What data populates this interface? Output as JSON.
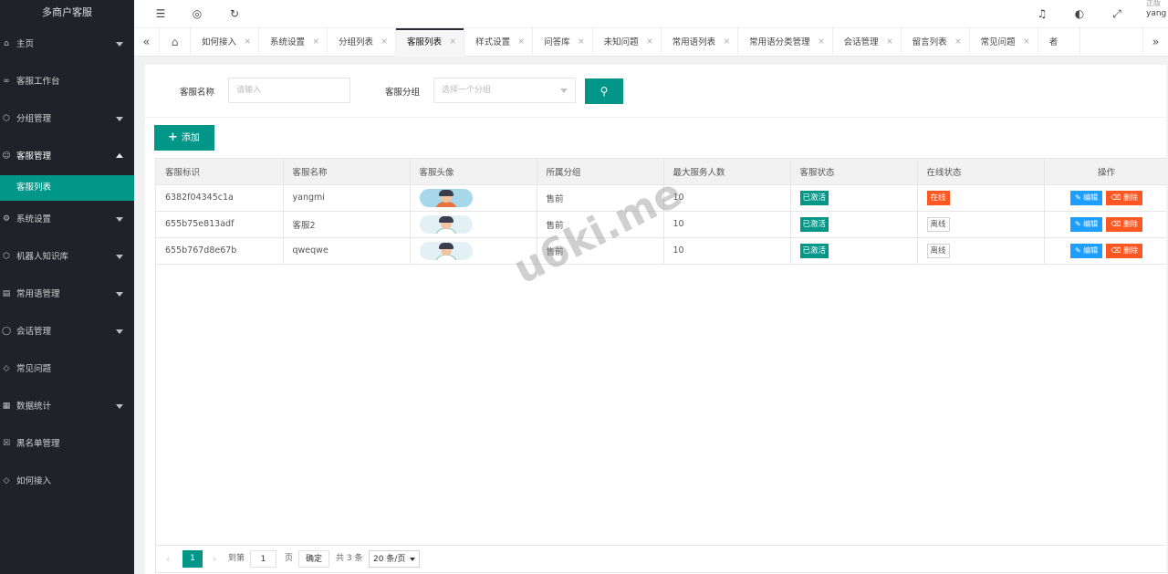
{
  "app": {
    "title": "多商户客服"
  },
  "header": {
    "menu_icon": "☰",
    "globe_icon": "◎",
    "refresh_icon": "↻",
    "bell_icon": "♫",
    "theme_icon": "◐",
    "fullscreen_icon": "⤢",
    "user_line1": "正版",
    "user_line2": "yang"
  },
  "sidebar": {
    "items": [
      {
        "label": "主页",
        "icon": "⌂"
      },
      {
        "label": "客服工作台",
        "icon": "∞"
      },
      {
        "label": "分组管理",
        "icon": "⬡"
      },
      {
        "label": "客服管理",
        "icon": "☺"
      },
      {
        "label": "客服列表",
        "icon": ""
      },
      {
        "label": "系统设置",
        "icon": "⚙"
      },
      {
        "label": "机器人知识库",
        "icon": "⬡"
      },
      {
        "label": "常用语管理",
        "icon": "▤"
      },
      {
        "label": "会话管理",
        "icon": "◯"
      },
      {
        "label": "常见问题",
        "icon": "◇"
      },
      {
        "label": "数据统计",
        "icon": "▦"
      },
      {
        "label": "黑名单管理",
        "icon": "☒"
      },
      {
        "label": "如何接入",
        "icon": "◇"
      }
    ]
  },
  "tabs": {
    "left_arrow": "«",
    "right_arrow": "»",
    "home_icon": "⌂",
    "close": "×",
    "items": [
      {
        "label": "如何接入"
      },
      {
        "label": "系统设置"
      },
      {
        "label": "分组列表"
      },
      {
        "label": "客服列表"
      },
      {
        "label": "样式设置"
      },
      {
        "label": "问答库"
      },
      {
        "label": "未知问题"
      },
      {
        "label": "常用语列表"
      },
      {
        "label": "常用语分类管理"
      },
      {
        "label": "会话管理"
      },
      {
        "label": "留言列表"
      },
      {
        "label": "常见问题"
      },
      {
        "label": "者"
      }
    ]
  },
  "search": {
    "name_label": "客服名称",
    "name_placeholder": "请输入",
    "group_label": "客服分组",
    "group_placeholder": "选择一个分组",
    "button_icon": "⚲"
  },
  "toolbar": {
    "add_icon": "+",
    "add_label": "添加"
  },
  "table": {
    "headers": [
      "客服标识",
      "客服名称",
      "客服头像",
      "所属分组",
      "最大服务人数",
      "客服状态",
      "在线状态",
      "操作"
    ],
    "edit_label": "✎ 编辑",
    "delete_label": "⌫ 删除",
    "rows": [
      {
        "id": "6382f04345c1a",
        "name": "yangmi",
        "avatar": "avatar-orange",
        "group": "售前",
        "max": "10",
        "status": "已激活",
        "online": "在线",
        "online_state": "online"
      },
      {
        "id": "655b75e813adf",
        "name": "客服2",
        "avatar": "avatar-light",
        "group": "售前",
        "max": "10",
        "status": "已激活",
        "online": "离线",
        "online_state": "offline"
      },
      {
        "id": "655b767d8e67b",
        "name": "qweqwe",
        "avatar": "avatar-light",
        "group": "售前",
        "max": "10",
        "status": "已激活",
        "online": "离线",
        "online_state": "offline"
      }
    ]
  },
  "pager": {
    "prev": "‹",
    "next": "›",
    "current": "1",
    "goto_label": "到第",
    "page_input": "1",
    "page_unit": "页",
    "ok": "确定",
    "total": "共 3 条",
    "size": "20 条/页"
  },
  "watermark": "u6ki.me",
  "colors": {
    "primary": "#009688",
    "danger": "#ff5722",
    "info": "#1e9fff",
    "sidebar": "#20222a"
  }
}
